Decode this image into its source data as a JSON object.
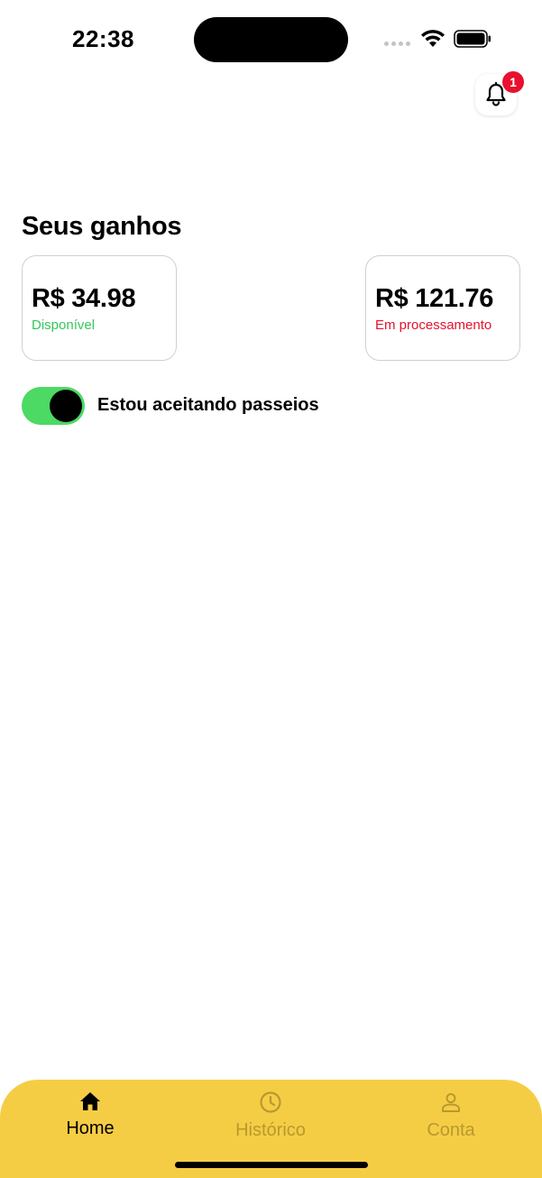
{
  "status_bar": {
    "time": "22:38",
    "icons": [
      "signal-dots-icon",
      "wifi-icon",
      "battery-icon"
    ]
  },
  "header": {
    "notification_icon": "bell-icon",
    "notification_count": "1",
    "badge_color": "#e8102e"
  },
  "earnings": {
    "title": "Seus ganhos",
    "cards": [
      {
        "amount": "R$ 34.98",
        "caption": "Disponível",
        "caption_color": "#34c759"
      },
      {
        "amount": "R$ 121.76",
        "caption": "Em processamento",
        "caption_color": "#e8102e"
      }
    ]
  },
  "availability": {
    "label": "Estou aceitando passeios",
    "enabled": true,
    "toggle_color": "#4cd964"
  },
  "tab_bar": {
    "background": "#f5cd45",
    "tabs": [
      {
        "label": "Home",
        "icon": "home-icon",
        "active": true
      },
      {
        "label": "Histórico",
        "icon": "clock-icon",
        "active": false
      },
      {
        "label": "Conta",
        "icon": "user-icon",
        "active": false
      }
    ]
  }
}
